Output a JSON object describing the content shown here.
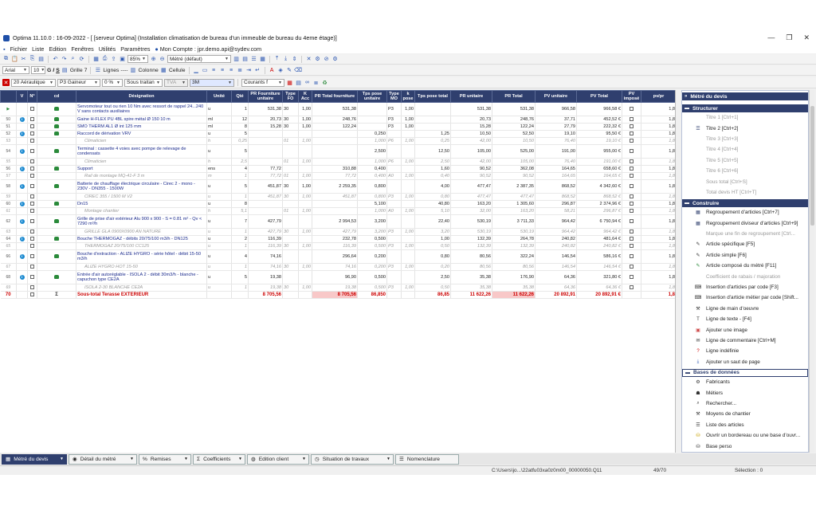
{
  "window": {
    "title": "Optima 11.10.0 : 16-09-2022 - [ [serveur Optima] (Installation climatisation de bureau d'un immeuble de bureau du 4eme étage)]"
  },
  "menu": [
    "Fichier",
    "Liste",
    "Edition",
    "Fenêtres",
    "Utilités",
    "Paramètres"
  ],
  "account": "Mon Compte : jpr.demo.api@sydev.com",
  "toolbar1": {
    "zoom": "85%",
    "metre": "Métré (défaut)"
  },
  "toolbar2": {
    "font": "Arial",
    "size": "10",
    "bold": "G",
    "italic": "I",
    "underline": "S",
    "grille_label": "Grille",
    "grille_value": "7",
    "lignes_label": "Lignes",
    "lignes_value": "----",
    "colonne_label": "Colonne",
    "cellule_label": "Cellule"
  },
  "toolbar3": {
    "lot": "Aéraulique",
    "lot_num": "20",
    "gainer": "Gaineur",
    "gainer_num": "P3",
    "pct": "0 %",
    "soustrait": "Sous traitan",
    "tva": "TVA",
    "ref": "3M",
    "courants": "Courants f"
  },
  "columns": [
    "",
    "V",
    "N°",
    "cd",
    "Désignation",
    "Unité",
    "Qté",
    "PR Fourniture unitaire",
    "Type FO",
    "K Acc",
    "PR Total fourniture",
    "Tps pose unitaire",
    "Type MO",
    "k pose",
    "Tps pose total",
    "PR unitaire",
    "PR Total",
    "PV unitaire",
    "PV Total",
    "PV imposé",
    "pv/pr"
  ],
  "rows": [
    {
      "n": "",
      "t": "main",
      "icon": "car",
      "des": "Servomoteur tout ou rien 10 Nm avec ressort de rappel 24...240 V sans contacts auxiliaires",
      "u": "u",
      "q": "1",
      "prf": "531,38",
      "tfo": "30",
      "ka": "1,00",
      "prtf": "531,38",
      "tpu": "",
      "tmo": "P3",
      "kp": "1,00",
      "tpt": "",
      "pru": "531,38",
      "prt": "531,38",
      "pvu": "966,58",
      "pvt": "966,58 €",
      "pvr": "1,8"
    },
    {
      "n": "50",
      "t": "main",
      "icon": "car",
      "des": "Gaine H-FLEX PU 4BL spire métal Ø 150 10 m",
      "u": "ml",
      "q": "12",
      "prf": "20,73",
      "tfo": "30",
      "ka": "1,00",
      "prtf": "248,76",
      "tpu": "",
      "tmo": "P3",
      "kp": "1,00",
      "tpt": "",
      "pru": "20,73",
      "prt": "248,76",
      "pvu": "37,71",
      "pvt": "452,52 €",
      "pvr": "1,8"
    },
    {
      "n": "51",
      "t": "main",
      "icon": "car",
      "des": "SMO THERM AL1 Ø int 125 mm",
      "u": "ml",
      "q": "8",
      "prf": "15,28",
      "tfo": "30",
      "ka": "1,00",
      "prtf": "122,24",
      "tpu": "",
      "tmo": "P3",
      "kp": "1,00",
      "tpt": "",
      "pru": "15,28",
      "prt": "122,24",
      "pvu": "27,79",
      "pvt": "222,32 €",
      "pvr": "1,8"
    },
    {
      "n": "52",
      "t": "main",
      "icon": "car",
      "des": "Raccord de dérivation VRV",
      "u": "u",
      "q": "5",
      "prf": "",
      "tfo": "",
      "ka": "",
      "prtf": "",
      "tpu": "0,250",
      "tmo": "",
      "kp": "",
      "tpt": "1,25",
      "pru": "10,50",
      "prt": "52,50",
      "pvu": "19,10",
      "pvt": "95,50 €",
      "pvr": "1,8"
    },
    {
      "n": "53",
      "t": "fourn",
      "icon": "",
      "des": "Climaticien",
      "u": "h",
      "q": "0,25",
      "prf": "",
      "tfo": "01",
      "ka": "1,00",
      "prtf": "",
      "tpu": "1,000",
      "tmo": "P6",
      "kp": "1,00",
      "tpt": "0,25",
      "pru": "42,00",
      "prt": "10,50",
      "pvu": "76,40",
      "pvt": "19,10 €",
      "pvr": "1,8"
    },
    {
      "n": "54",
      "t": "main",
      "icon": "car",
      "des": "Terminal : cassette 4 voies avec pompe de relevage de condensats",
      "u": "u",
      "q": "5",
      "prf": "",
      "tfo": "",
      "ka": "",
      "prtf": "",
      "tpu": "2,500",
      "tmo": "",
      "kp": "",
      "tpt": "12,50",
      "pru": "105,00",
      "prt": "525,00",
      "pvu": "191,00",
      "pvt": "955,00 €",
      "pvr": "1,8"
    },
    {
      "n": "55",
      "t": "fourn",
      "icon": "",
      "des": "Climaticien",
      "u": "h",
      "q": "2,5",
      "prf": "",
      "tfo": "01",
      "ka": "1,00",
      "prtf": "",
      "tpu": "1,000",
      "tmo": "P6",
      "kp": "1,00",
      "tpt": "2,50",
      "pru": "42,00",
      "prt": "105,00",
      "pvu": "76,40",
      "pvt": "191,00 €",
      "pvr": "1,8"
    },
    {
      "n": "56",
      "t": "main",
      "icon": "car",
      "des": "Support",
      "u": "ens",
      "q": "4",
      "prf": "77,72",
      "tfo": "",
      "ka": "",
      "prtf": "310,88",
      "tpu": "0,400",
      "tmo": "",
      "kp": "",
      "tpt": "1,60",
      "pru": "90,52",
      "prt": "362,08",
      "pvu": "164,65",
      "pvt": "658,60 €",
      "pvr": "1,8"
    },
    {
      "n": "57",
      "t": "fourn",
      "icon": "",
      "des": "Rail de montage MQ-41-F 3 m",
      "u": "m",
      "q": "1",
      "prf": "77,72",
      "tfo": "01",
      "ka": "1,00",
      "prtf": "77,72",
      "tpu": "0,400",
      "tmo": "A0",
      "kp": "1,00",
      "tpt": "0,40",
      "pru": "90,52",
      "prt": "90,52",
      "pvu": "164,65",
      "pvt": "164,65 €",
      "pvr": "1,8"
    },
    {
      "n": "58",
      "t": "main",
      "icon": "car",
      "des": "Batterie de chauffage électrique circulaire - Cirec 2 - mono - 230V - DN355 - 1500W",
      "u": "u",
      "q": "5",
      "prf": "451,87",
      "tfo": "30",
      "ka": "1,00",
      "prtf": "2 259,35",
      "tpu": "0,800",
      "tmo": "",
      "kp": "",
      "tpt": "4,00",
      "pru": "477,47",
      "prt": "2 387,35",
      "pvu": "868,52",
      "pvt": "4 342,60 €",
      "pvr": "1,8"
    },
    {
      "n": "59",
      "t": "fourn",
      "icon": "",
      "des": "CIREC 355 / 1500 M V2",
      "u": "u",
      "q": "1",
      "prf": "451,87",
      "tfo": "30",
      "ka": "1,00",
      "prtf": "451,87",
      "tpu": "0,800",
      "tmo": "P3",
      "kp": "1,00",
      "tpt": "0,80",
      "pru": "477,47",
      "prt": "477,47",
      "pvu": "868,52",
      "pvt": "868,52 €",
      "pvr": "1,8"
    },
    {
      "n": "60",
      "t": "main",
      "icon": "car",
      "des": "Dn15",
      "u": "u",
      "q": "8",
      "prf": "",
      "tfo": "",
      "ka": "",
      "prtf": "",
      "tpu": "5,100",
      "tmo": "",
      "kp": "",
      "tpt": "40,80",
      "pru": "163,20",
      "prt": "1 305,60",
      "pvu": "296,87",
      "pvt": "2 374,96 €",
      "pvr": "1,8"
    },
    {
      "n": "61",
      "t": "fourn",
      "icon": "",
      "des": "Montage chantier",
      "u": "h",
      "q": "5,1",
      "prf": "",
      "tfo": "01",
      "ka": "1,00",
      "prtf": "",
      "tpu": "1,000",
      "tmo": "A0",
      "kp": "1,00",
      "tpt": "5,10",
      "pru": "32,00",
      "prt": "163,20",
      "pvu": "58,21",
      "pvt": "296,87 €",
      "pvr": "1,8"
    },
    {
      "n": "62",
      "t": "main",
      "icon": "car",
      "des": "Grille de prise d'air extérieur Alu 900 x 900 - S = 0.81 m² - Qv < 7290 m³/h",
      "u": "u",
      "q": "7",
      "prf": "427,79",
      "tfo": "",
      "ka": "",
      "prtf": "2 994,53",
      "tpu": "3,200",
      "tmo": "",
      "kp": "",
      "tpt": "22,40",
      "pru": "530,19",
      "prt": "3 711,33",
      "pvu": "964,42",
      "pvt": "6 750,94 €",
      "pvr": "1,8"
    },
    {
      "n": "63",
      "t": "fourn",
      "icon": "",
      "des": "GRILLE GLA 0900X0900 AN NATURE",
      "u": "u",
      "q": "1",
      "prf": "427,79",
      "tfo": "30",
      "ka": "1,00",
      "prtf": "427,79",
      "tpu": "3,200",
      "tmo": "P3",
      "kp": "1,00",
      "tpt": "3,20",
      "pru": "530,19",
      "prt": "530,19",
      "pvu": "964,42",
      "pvt": "964,42 €",
      "pvr": "1,8"
    },
    {
      "n": "64",
      "t": "main",
      "icon": "car",
      "des": "Bouche THERMOGAZ - débits 20/75/100 m3/h - DN125",
      "u": "u",
      "q": "2",
      "prf": "116,39",
      "tfo": "",
      "ka": "",
      "prtf": "232,78",
      "tpu": "0,500",
      "tmo": "",
      "kp": "",
      "tpt": "1,00",
      "pru": "132,39",
      "prt": "264,78",
      "pvu": "240,82",
      "pvt": "481,64 €",
      "pvr": "1,8"
    },
    {
      "n": "65",
      "t": "fourn",
      "icon": "",
      "des": "THERMOGAZ 20/75/100 CC125",
      "u": "u",
      "q": "1",
      "prf": "116,39",
      "tfo": "30",
      "ka": "1,00",
      "prtf": "116,39",
      "tpu": "0,500",
      "tmo": "P3",
      "kp": "1,00",
      "tpt": "0,50",
      "pru": "132,39",
      "prt": "132,39",
      "pvu": "240,82",
      "pvt": "240,82 €",
      "pvr": "1,8"
    },
    {
      "n": "66",
      "t": "main",
      "icon": "car",
      "des": "Bouche d'extraction - ALIZE HYGRO - série hôtel - débit 15-50 m3/h",
      "u": "u",
      "q": "4",
      "prf": "74,16",
      "tfo": "",
      "ka": "",
      "prtf": "296,64",
      "tpu": "0,200",
      "tmo": "",
      "kp": "",
      "tpt": "0,80",
      "pru": "80,56",
      "prt": "322,24",
      "pvu": "146,54",
      "pvt": "586,16 €",
      "pvr": "1,8"
    },
    {
      "n": "67",
      "t": "fourn",
      "icon": "",
      "des": "ALIZE HYGRO HOT 15-50",
      "u": "u",
      "q": "1",
      "prf": "74,16",
      "tfo": "30",
      "ka": "1,00",
      "prtf": "74,16",
      "tpu": "0,200",
      "tmo": "P3",
      "kp": "1,00",
      "tpt": "0,20",
      "pru": "80,56",
      "prt": "80,56",
      "pvu": "146,54",
      "pvt": "146,54 €",
      "pvr": "1,8"
    },
    {
      "n": "68",
      "t": "main",
      "icon": "car",
      "des": "Entrée d'air autoréglable - ISOLA 2 - débit 30m3/h - blanche - capuchon type CE2A",
      "u": "u",
      "q": "5",
      "prf": "19,38",
      "tfo": "",
      "ka": "",
      "prtf": "96,90",
      "tpu": "0,500",
      "tmo": "",
      "kp": "",
      "tpt": "2,50",
      "pru": "35,38",
      "prt": "176,90",
      "pvu": "64,36",
      "pvt": "321,80 €",
      "pvr": "1,8"
    },
    {
      "n": "69",
      "t": "fourn",
      "icon": "",
      "des": "ISOLA 2-30 BLANCHE CE2A",
      "u": "u",
      "q": "1",
      "prf": "19,38",
      "tfo": "30",
      "ka": "1,00",
      "prtf": "19,38",
      "tpu": "0,500",
      "tmo": "P3",
      "kp": "1,00",
      "tpt": "0,50",
      "pru": "35,38",
      "prt": "35,38",
      "pvu": "64,36",
      "pvt": "64,36 €",
      "pvr": "1,8"
    },
    {
      "n": "70",
      "t": "sub",
      "icon": "sum",
      "des": "Sous-total Terasse EXTERIEUR",
      "u": "",
      "q": "",
      "prf": "8 705,56",
      "tfo": "",
      "ka": "",
      "prtf": "8 705,56",
      "tpu": "86,850",
      "tmo": "",
      "kp": "",
      "tpt": "86,85",
      "pru": "11 622,26",
      "prt": "11 622,26",
      "pvu": "20 892,91",
      "pvt": "20 892,91 €",
      "pvr": "1,8"
    }
  ],
  "side": {
    "header": "Métré du devis",
    "structurer": {
      "title": "Structurer",
      "items": [
        "Titre 1 [Ctrl+1]",
        "Titre 2 [Ctrl+2]",
        "Titre 3 [Ctrl+3]",
        "Titre 4 [Ctrl+4]",
        "Titre 5 [Ctrl+5]",
        "Titre 6 [Ctrl+6]",
        "Sous total [Ctrl+S]",
        "Total devis HT [Ctrl+T]"
      ]
    },
    "construire": {
      "title": "Construire",
      "items": [
        "Regroupement d'articles [Ctrl+7]",
        "Regroupement diviseur d'articles [Ctrl+9]",
        "Marque une fin de regroupement [Ctrl...",
        "Article spécifique [F5]",
        "Article simple [F6]",
        "Article composé du métré [F11]",
        "Coefficient de rabais / majoration",
        "Insertion d'articles par code [F3]",
        "Insertion d'article métier par code [Shift...",
        "Ligne de main d'oeuvre",
        "Ligne de texte - [F4]",
        "Ajouter une image",
        "Ligne de commentaire [Ctrl+M]",
        "Ligne indéfinie",
        "Ajouter un saut de page"
      ]
    },
    "bases": {
      "title": "Bases de données",
      "items": [
        "Fabricants",
        "Métiers",
        "Rechercher...",
        "Moyens de chantier",
        "Liste des articles",
        "Ouvrir un bordereau ou une base d'ouvr...",
        "Base perso"
      ]
    }
  },
  "tabs": [
    "Métré du devis",
    "Détail du métré",
    "Remises",
    "Coefficients",
    "Edition client",
    "Situation de travaux",
    "Nomenclature"
  ],
  "status": {
    "path": "C:\\Users\\jo...\\22atfu03xa0z0m00_00000050.Q11",
    "position": "49/70",
    "selection": "Sélection : 0"
  },
  "colors": {
    "header": "#2f3f6e",
    "subtotal": "#cc0000",
    "pink": "#f8c8c8"
  }
}
